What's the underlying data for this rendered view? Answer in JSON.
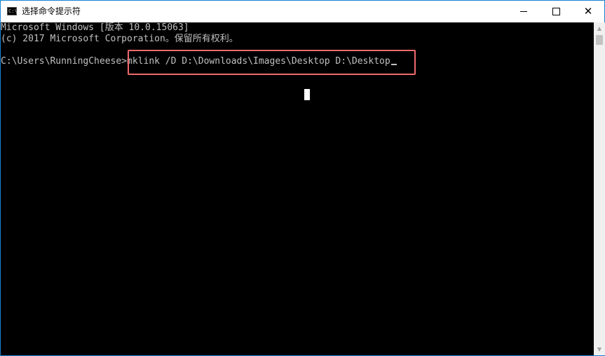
{
  "window": {
    "title": "选择命令提示符",
    "icon_label": "C:\\"
  },
  "controls": {
    "minimize_icon": "minimize-icon",
    "maximize_icon": "maximize-icon",
    "close_icon": "close-icon",
    "close_glyph": "✕"
  },
  "console": {
    "line1": "Microsoft Windows [版本 10.0.15063]",
    "line2": "(c) 2017 Microsoft Corporation。保留所有权利。",
    "line3": "C:\\Users\\RunningCheese>mklink /D D:\\Downloads\\Images\\Desktop D:\\Desktop"
  },
  "colors": {
    "window_border": "#1883d7",
    "console_bg": "#000000",
    "console_text": "#c0c0c0",
    "highlight": "#f0696c"
  },
  "scrollbar": {
    "up_arrow": "▲",
    "down_arrow": "▼"
  }
}
